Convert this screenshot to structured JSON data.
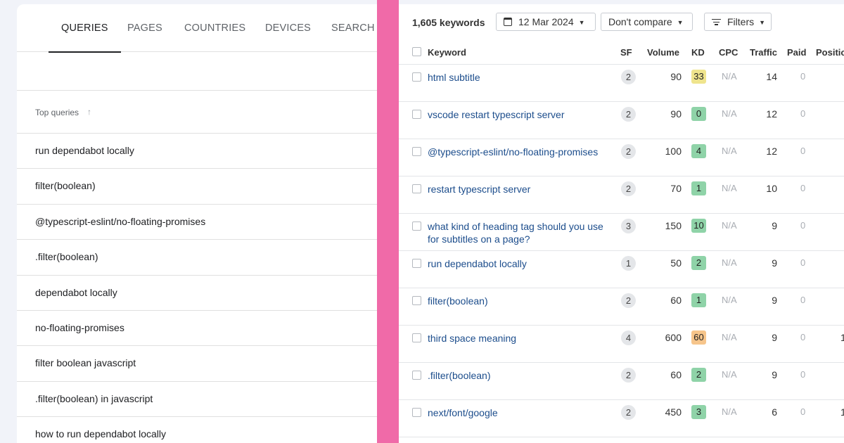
{
  "left_panel": {
    "tabs": [
      {
        "label": "QUERIES",
        "active": true
      },
      {
        "label": "PAGES",
        "active": false
      },
      {
        "label": "COUNTRIES",
        "active": false
      },
      {
        "label": "DEVICES",
        "active": false
      },
      {
        "label": "SEARCH APPEARANCE",
        "active": false
      }
    ],
    "table_header": {
      "label": "Top queries",
      "sort_up_icon": "↑",
      "sort_down_icon": "↓"
    },
    "rows": [
      "run dependabot locally",
      "filter(boolean)",
      "@typescript-eslint/no-floating-promises",
      ".filter(boolean)",
      "dependabot locally",
      "no-floating-promises",
      "filter boolean javascript",
      ".filter(boolean) in javascript",
      "how to run dependabot locally"
    ]
  },
  "divider_color": "#f06aa8",
  "right_panel": {
    "toolbar": {
      "keyword_count": "1,605 keywords",
      "date": "12 Mar 2024",
      "compare": "Don't compare",
      "filters": "Filters",
      "caret": "▼"
    },
    "columns": {
      "keyword": "Keyword",
      "sf": "SF",
      "volume": "Volume",
      "kd": "KD",
      "cpc": "CPC",
      "traffic": "Traffic",
      "paid": "Paid",
      "position": "Position"
    },
    "kd_colors": {
      "green": "#8fd3a8",
      "yellow": "#efe48d",
      "orange": "#f6c58b"
    },
    "rows": [
      {
        "keyword": "html subtitle",
        "sf": "2",
        "volume": "90",
        "kd": "33",
        "kd_color": "#efe48d",
        "cpc": "N/A",
        "traffic": "14",
        "paid": "0",
        "position": ""
      },
      {
        "keyword": "vscode restart typescript server",
        "sf": "2",
        "volume": "90",
        "kd": "0",
        "kd_color": "#8fd3a8",
        "cpc": "N/A",
        "traffic": "12",
        "paid": "0",
        "position": ""
      },
      {
        "keyword": "@typescript-eslint/no-floating-promises",
        "sf": "2",
        "volume": "100",
        "kd": "4",
        "kd_color": "#8fd3a8",
        "cpc": "N/A",
        "traffic": "12",
        "paid": "0",
        "position": ""
      },
      {
        "keyword": "restart typescript server",
        "sf": "2",
        "volume": "70",
        "kd": "1",
        "kd_color": "#8fd3a8",
        "cpc": "N/A",
        "traffic": "10",
        "paid": "0",
        "position": ""
      },
      {
        "keyword": "what kind of heading tag should you use for subtitles on a page?",
        "sf": "3",
        "volume": "150",
        "kd": "10",
        "kd_color": "#8fd3a8",
        "cpc": "N/A",
        "traffic": "9",
        "paid": "0",
        "position": ""
      },
      {
        "keyword": "run dependabot locally",
        "sf": "1",
        "volume": "50",
        "kd": "2",
        "kd_color": "#8fd3a8",
        "cpc": "N/A",
        "traffic": "9",
        "paid": "0",
        "position": ""
      },
      {
        "keyword": "filter(boolean)",
        "sf": "2",
        "volume": "60",
        "kd": "1",
        "kd_color": "#8fd3a8",
        "cpc": "N/A",
        "traffic": "9",
        "paid": "0",
        "position": ""
      },
      {
        "keyword": "third space meaning",
        "sf": "4",
        "volume": "600",
        "kd": "60",
        "kd_color": "#f6c58b",
        "cpc": "N/A",
        "traffic": "9",
        "paid": "0",
        "position": "1"
      },
      {
        "keyword": ".filter(boolean)",
        "sf": "2",
        "volume": "60",
        "kd": "2",
        "kd_color": "#8fd3a8",
        "cpc": "N/A",
        "traffic": "9",
        "paid": "0",
        "position": ""
      },
      {
        "keyword": "next/font/google",
        "sf": "2",
        "volume": "450",
        "kd": "3",
        "kd_color": "#8fd3a8",
        "cpc": "N/A",
        "traffic": "6",
        "paid": "0",
        "position": "1"
      }
    ]
  }
}
